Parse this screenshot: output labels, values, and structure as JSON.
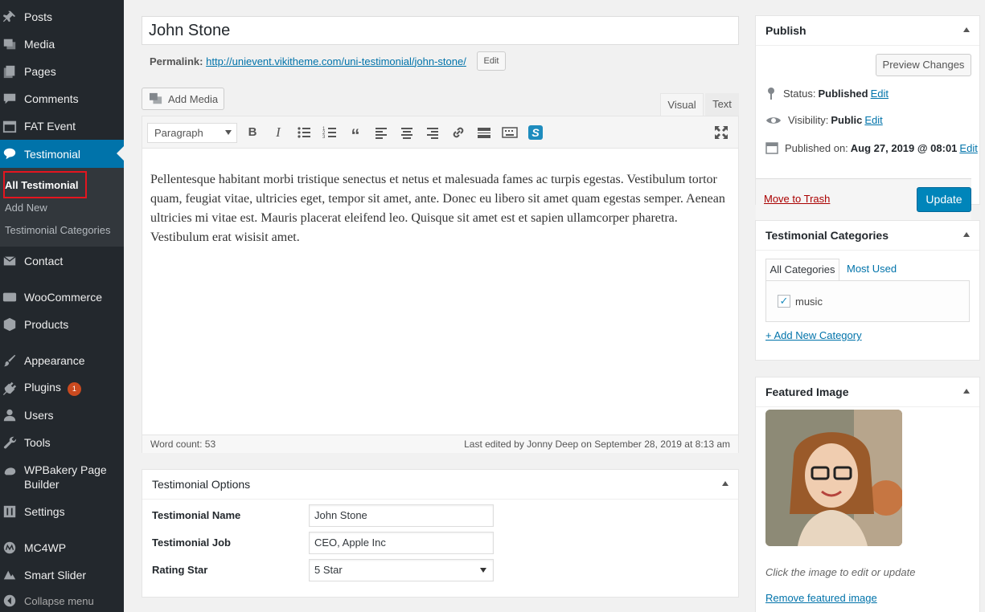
{
  "sidebar": {
    "items": [
      {
        "label": "Posts",
        "icon": "pin-icon"
      },
      {
        "label": "Media",
        "icon": "media-icon"
      },
      {
        "label": "Pages",
        "icon": "pages-icon"
      },
      {
        "label": "Comments",
        "icon": "comment-icon"
      },
      {
        "label": "FAT Event",
        "icon": "calendar-icon"
      },
      {
        "label": "Testimonial",
        "icon": "speech-bubble-icon"
      },
      {
        "label": "Contact",
        "icon": "mail-icon"
      },
      {
        "label": "WooCommerce",
        "icon": "woo-icon"
      },
      {
        "label": "Products",
        "icon": "box-icon"
      },
      {
        "label": "Appearance",
        "icon": "brush-icon"
      },
      {
        "label": "Plugins",
        "icon": "plug-icon",
        "badge": "1"
      },
      {
        "label": "Users",
        "icon": "user-icon"
      },
      {
        "label": "Tools",
        "icon": "wrench-icon"
      },
      {
        "label": "WPBakery Page Builder",
        "icon": "wpbakery-icon"
      },
      {
        "label": "Settings",
        "icon": "settings-icon"
      },
      {
        "label": "MC4WP",
        "icon": "mc4wp-icon"
      },
      {
        "label": "Smart Slider",
        "icon": "slider-icon"
      }
    ],
    "submenu": [
      "All Testimonial",
      "Add New",
      "Testimonial Categories"
    ],
    "collapse": "Collapse menu"
  },
  "editor": {
    "title": "John Stone",
    "permalink_label": "Permalink:",
    "permalink_base": "http://unievent.vikitheme.com/uni-testimonial/",
    "permalink_slug": "john-stone",
    "permalink_trail": "/",
    "edit_label": "Edit",
    "add_media": "Add Media",
    "tab_visual": "Visual",
    "tab_text": "Text",
    "format": "Paragraph",
    "content": "Pellentesque habitant morbi tristique senectus et netus et malesuada fames ac turpis egestas. Vestibulum tortor quam, feugiat vitae, ultricies eget, tempor sit amet, ante. Donec eu libero sit amet quam egestas semper. Aenean ultricies mi vitae est. Mauris placerat eleifend leo. Quisque sit amet est et sapien ullamcorper pharetra. Vestibulum erat wisisit amet.",
    "word_count": "Word count: 53",
    "last_edited": "Last edited by Jonny Deep on September 28, 2019 at 8:13 am"
  },
  "testimonial_options": {
    "title": "Testimonial Options",
    "name_label": "Testimonial Name",
    "name_value": "John Stone",
    "job_label": "Testimonial Job",
    "job_value": "CEO, Apple Inc",
    "rating_label": "Rating Star",
    "rating_value": "5 Star"
  },
  "publish": {
    "title": "Publish",
    "preview": "Preview Changes",
    "status_label": "Status:",
    "status_value": "Published",
    "visibility_label": "Visibility:",
    "visibility_value": "Public",
    "published_label": "Published on:",
    "published_value": "Aug 27, 2019 @ 08:01",
    "edit": "Edit",
    "trash": "Move to Trash",
    "update": "Update"
  },
  "categories": {
    "title": "Testimonial Categories",
    "tab_all": "All Categories",
    "tab_used": "Most Used",
    "items": [
      {
        "label": "music",
        "checked": true
      }
    ],
    "add_new": "+ Add New Category"
  },
  "featured": {
    "title": "Featured Image",
    "hint": "Click the image to edit or update",
    "remove": "Remove featured image"
  },
  "colors": {
    "accent": "#0073aa",
    "sidebar": "#23282d",
    "primary_button": "#0085ba",
    "highlight_box": "#e4151f"
  }
}
